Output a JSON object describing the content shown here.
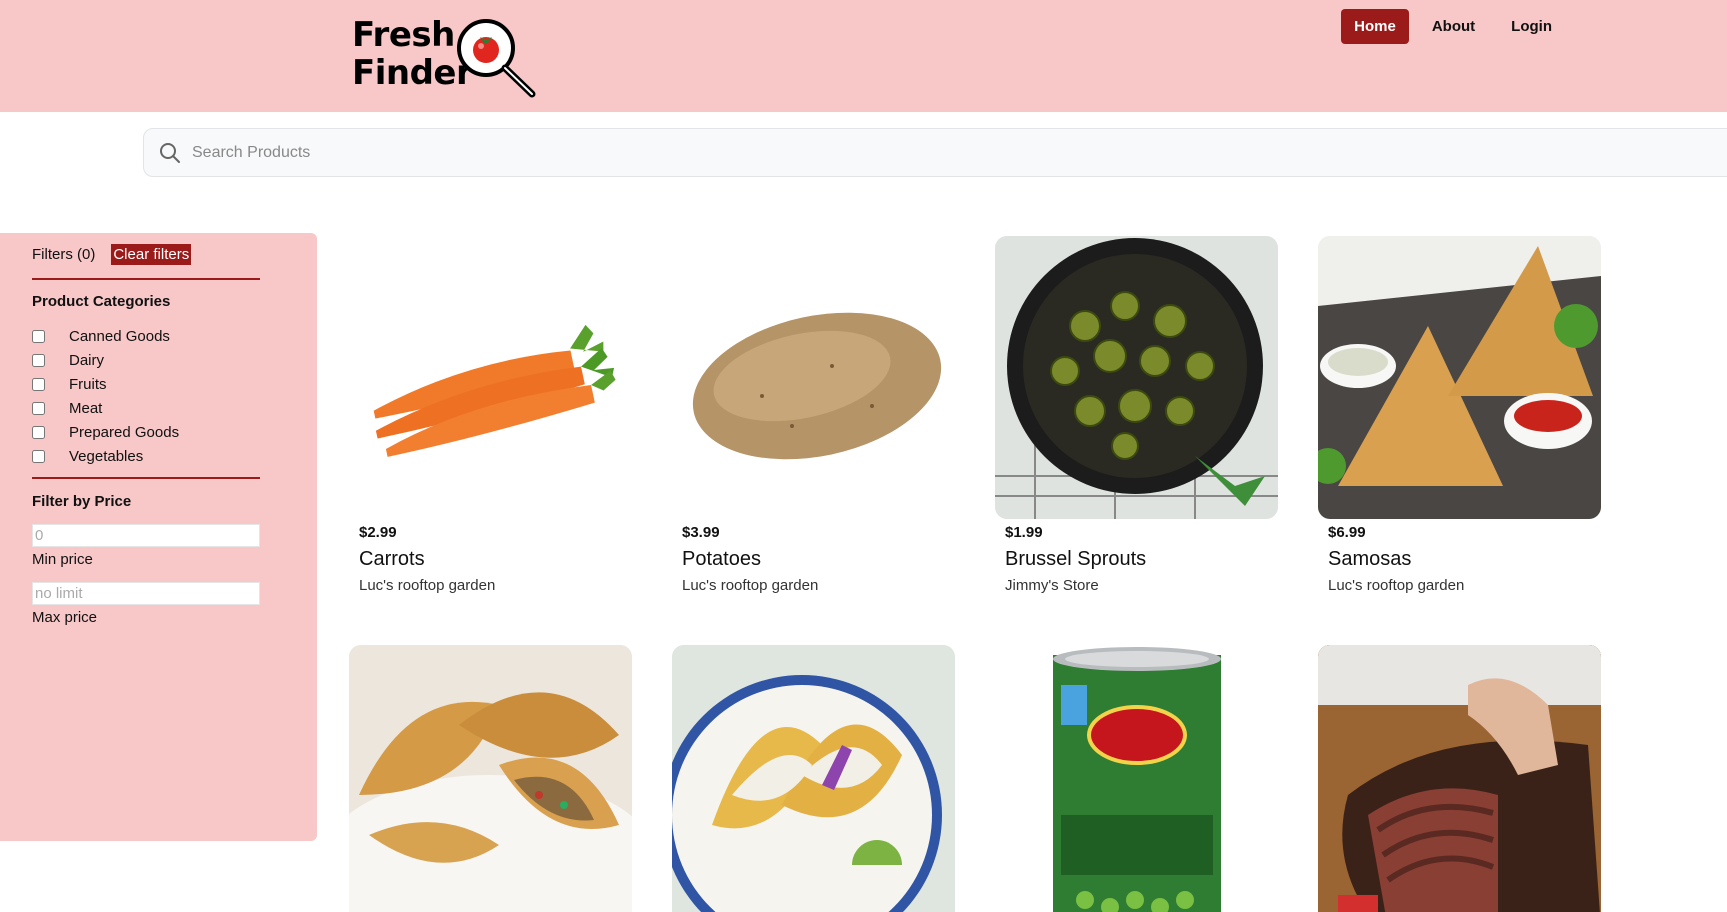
{
  "header": {
    "logo_line1": "Fresh",
    "logo_line2": "Finder",
    "nav": [
      {
        "label": "Home",
        "active": true
      },
      {
        "label": "About",
        "active": false
      },
      {
        "label": "Login",
        "active": false
      }
    ]
  },
  "search": {
    "placeholder": "Search Products"
  },
  "sidebar": {
    "filters_label": "Filters (0)",
    "clear_label": "Clear filters",
    "categories_title": "Product Categories",
    "categories": [
      "Canned Goods",
      "Dairy",
      "Fruits",
      "Meat",
      "Prepared Goods",
      "Vegetables"
    ],
    "price_title": "Filter by Price",
    "min_placeholder": "0",
    "min_label": "Min price",
    "max_placeholder": "no limit",
    "max_label": "Max price"
  },
  "products": [
    {
      "price": "$2.99",
      "name": "Carrots",
      "store": "Luc's rooftop garden",
      "image": "carrot-icon"
    },
    {
      "price": "$3.99",
      "name": "Potatoes",
      "store": "Luc's rooftop garden",
      "image": "potato-icon"
    },
    {
      "price": "$1.99",
      "name": "Brussel Sprouts",
      "store": "Jimmy's Store",
      "image": "brussel-sprouts-pan"
    },
    {
      "price": "$6.99",
      "name": "Samosas",
      "store": "Luc's rooftop garden",
      "image": "samosa-plate"
    },
    {
      "image": "empanadas-plate"
    },
    {
      "image": "fish-tacos-plate"
    },
    {
      "image": "sweet-peas-can"
    },
    {
      "image": "brisket-board"
    }
  ],
  "colors": {
    "accent": "#9b1a1a",
    "header_bg": "#f8c8c8",
    "sidebar_bg": "#f8c8c8"
  }
}
